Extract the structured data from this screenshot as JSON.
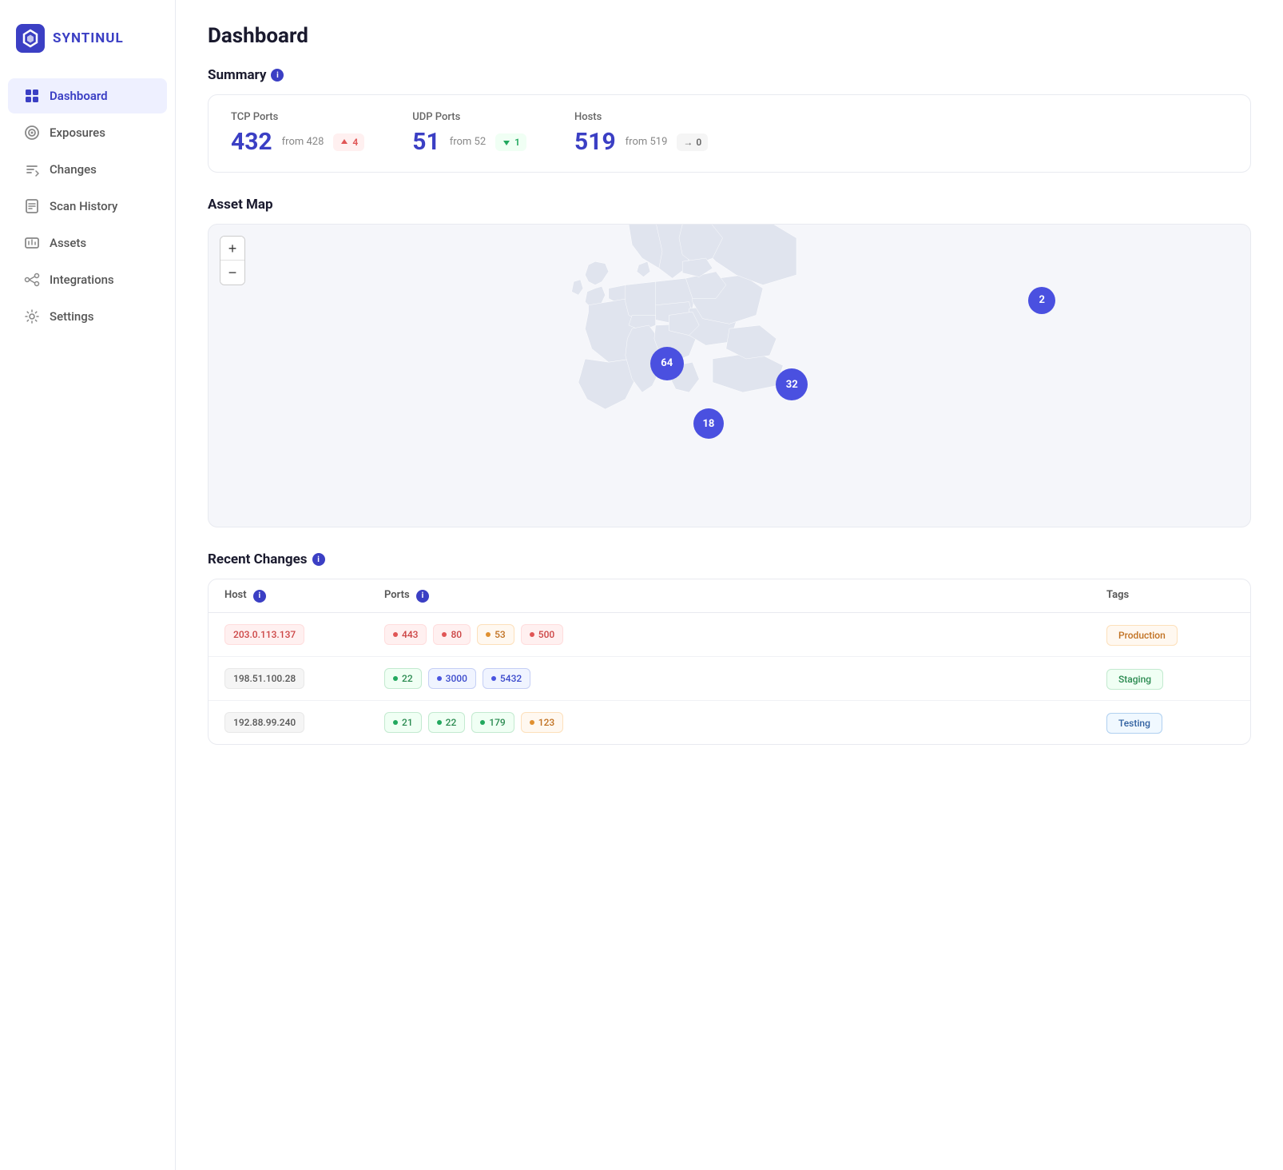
{
  "app": {
    "name": "SYNTINUL"
  },
  "sidebar": {
    "items": [
      {
        "id": "dashboard",
        "label": "Dashboard",
        "active": true
      },
      {
        "id": "exposures",
        "label": "Exposures",
        "active": false
      },
      {
        "id": "changes",
        "label": "Changes",
        "active": false
      },
      {
        "id": "scan-history",
        "label": "Scan History",
        "active": false
      },
      {
        "id": "assets",
        "label": "Assets",
        "active": false
      },
      {
        "id": "integrations",
        "label": "Integrations",
        "active": false
      },
      {
        "id": "settings",
        "label": "Settings",
        "active": false
      }
    ]
  },
  "dashboard": {
    "title": "Dashboard",
    "summary": {
      "heading": "Summary",
      "stats": [
        {
          "label": "TCP Ports",
          "value": "432",
          "from": "from 428",
          "badge_type": "up",
          "badge_value": "4"
        },
        {
          "label": "UDP Ports",
          "value": "51",
          "from": "from 52",
          "badge_type": "down",
          "badge_value": "1"
        },
        {
          "label": "Hosts",
          "value": "519",
          "from": "from 519",
          "badge_type": "neutral",
          "badge_value": "0"
        }
      ]
    },
    "asset_map": {
      "heading": "Asset Map",
      "zoom_in": "+",
      "zoom_out": "−",
      "clusters": [
        {
          "label": "64",
          "top": "46%",
          "left": "44%",
          "size": 42
        },
        {
          "label": "32",
          "top": "53%",
          "left": "56%",
          "size": 40
        },
        {
          "label": "18",
          "top": "66%",
          "left": "48%",
          "size": 38
        },
        {
          "label": "2",
          "top": "25%",
          "left": "80%",
          "size": 34
        }
      ]
    },
    "recent_changes": {
      "heading": "Recent Changes",
      "columns": [
        "Host",
        "Ports",
        "Tags"
      ],
      "rows": [
        {
          "host": "203.0.113.137",
          "host_style": "red",
          "ports": [
            {
              "value": "443",
              "style": "red"
            },
            {
              "value": "80",
              "style": "red"
            },
            {
              "value": "53",
              "style": "orange"
            },
            {
              "value": "500",
              "style": "red"
            }
          ],
          "tag": "Production",
          "tag_style": "production"
        },
        {
          "host": "198.51.100.28",
          "host_style": "gray",
          "ports": [
            {
              "value": "22",
              "style": "green"
            },
            {
              "value": "3000",
              "style": "blue"
            },
            {
              "value": "5432",
              "style": "blue"
            }
          ],
          "tag": "Staging",
          "tag_style": "staging"
        },
        {
          "host": "192.88.99.240",
          "host_style": "gray",
          "ports": [
            {
              "value": "21",
              "style": "green"
            },
            {
              "value": "22",
              "style": "green"
            },
            {
              "value": "179",
              "style": "green"
            },
            {
              "value": "123",
              "style": "orange"
            }
          ],
          "tag": "Testing",
          "tag_style": "testing"
        }
      ]
    }
  }
}
